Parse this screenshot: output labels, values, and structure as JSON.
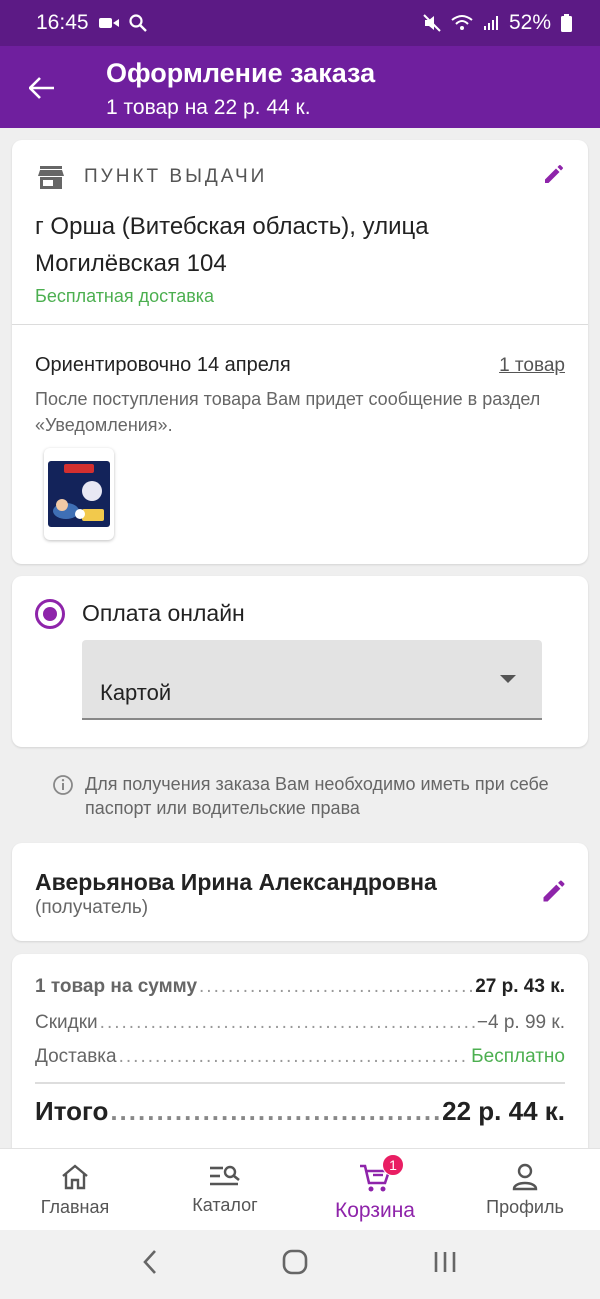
{
  "status_bar": {
    "time": "16:45",
    "battery": "52%"
  },
  "app_bar": {
    "title": "Оформление заказа",
    "subtitle": "1 товар на 22 р. 44 к."
  },
  "pickup": {
    "header": "ПУНКТ ВЫДАЧИ",
    "address": "г Орша (Витебская область), улица Могилёвская 104",
    "delivery": "Бесплатная доставка",
    "eta": "Ориентировочно 14 апреля",
    "items_link": "1 товар",
    "note": "После поступления товара Вам придет сообщение в раздел «Уведомления»."
  },
  "payment": {
    "option": "Оплата онлайн",
    "method": "Картой"
  },
  "info_note": "Для получения заказа Вам необходимо иметь при себе паспорт или водительские права",
  "recipient": {
    "name": "Аверьянова Ирина Александровна",
    "role": "(получатель)"
  },
  "summary": {
    "items_label": "1 товар на сумму",
    "items_value": "27 р. 43 к.",
    "discount_label": "Скидки",
    "discount_value": "−4 р. 99 к.",
    "delivery_label": "Доставка",
    "delivery_value": "Бесплатно",
    "total_label": "Итого",
    "total_value": "22 р. 44 к."
  },
  "bottom_nav": {
    "items": [
      {
        "label": "Главная",
        "icon": "home-icon"
      },
      {
        "label": "Каталог",
        "icon": "catalog-search-icon"
      },
      {
        "label": "Корзина",
        "icon": "cart-icon",
        "badge": "1",
        "active": true
      },
      {
        "label": "Профиль",
        "icon": "profile-icon"
      }
    ]
  },
  "colors": {
    "primary": "#6f1f9e",
    "accent": "#8e24aa",
    "success": "#4caf50",
    "badge": "#e91e63"
  }
}
